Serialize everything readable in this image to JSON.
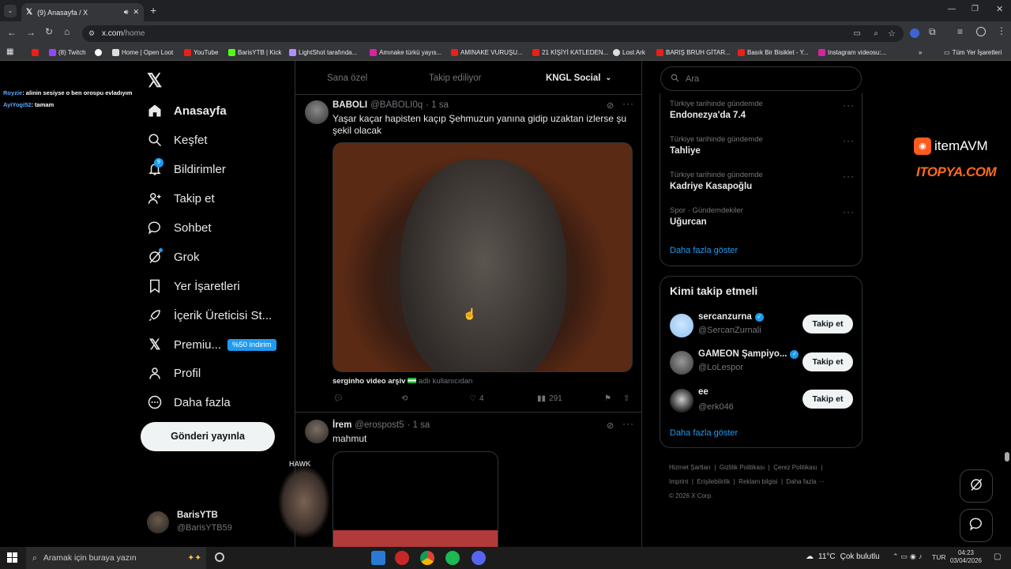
{
  "browser": {
    "tab_title": "(9) Anasayfa / X",
    "url_domain": "x.com",
    "url_path": "/home",
    "all_bookmarks": "Tüm Yer İşaretleri",
    "bookmarks": [
      "(8) Twitch",
      "Home | Open Loot",
      "YouTube",
      "BarisYTB | Kick",
      "LightShot tarafında...",
      "Amınake türkü yayıs...",
      "AMINAKE VURUŞU...",
      "21 KİŞİYİ KATLEDEN...",
      "Lost Ark",
      "BARIŞ BRUH GİTAR...",
      "Basık Bir Bisiklet - Y...",
      "Instagram videosu:..."
    ]
  },
  "stream_chat": [
    {
      "user": "Royzie",
      "msg": ": alinin sesiyse o ben orospu evladıyım"
    },
    {
      "user": "AyiYogi52",
      "msg": ": tamam"
    }
  ],
  "nav": {
    "items": [
      "Anasayfa",
      "Keşfet",
      "Bildirimler",
      "Takip et",
      "Sohbet",
      "Grok",
      "Yer İşaretleri",
      "İçerik Üreticisi St...",
      "Premiu...",
      "Profil",
      "Daha fazla"
    ],
    "notif_count": "9",
    "premium_badge": "%50 indirim",
    "post_button": "Gönderi yayınla",
    "account_name": "BarisYTB",
    "account_handle": "@BarisYTB59"
  },
  "feed_tabs": [
    "Sana özel",
    "Takip ediliyor",
    "KNGL Social"
  ],
  "tweets": [
    {
      "name": "BABOLI",
      "handle": "@BABOLI0q",
      "time": "· 1 sa",
      "text": "Yaşar kaçar hapisten kaçıp Şehmuzun yanına gidip uzaktan izlerse şu şekil olacak",
      "source_bold": "serginho video arşiv",
      "source_rest": "adlı kullanıcıdan",
      "likes": "4",
      "views": "291"
    },
    {
      "name": "İrem",
      "handle": "@erospost5",
      "time": "· 1 sa",
      "text": "mahmut"
    }
  ],
  "search": {
    "placeholder": "Ara"
  },
  "trends": [
    {
      "cat": "Türkiye tarihinde gündemde",
      "name": "Endonezya'da 7.4"
    },
    {
      "cat": "Türkiye tarihinde gündemde",
      "name": "Tahliye"
    },
    {
      "cat": "Türkiye tarihinde gündemde",
      "name": "Kadriye Kasapoğlu"
    },
    {
      "cat": "Spor · Gündemdekiler",
      "name": "Uğurcan"
    }
  ],
  "show_more": "Daha fazla göster",
  "who_to_follow": {
    "title": "Kimi takip etmeli",
    "users": [
      {
        "name": "sercanzurna",
        "handle": "@SercanZurnali",
        "btn": "Takip et"
      },
      {
        "name": "GAMEON Şampiyo...",
        "handle": "@LoLespor",
        "btn": "Takip et"
      },
      {
        "name": "ee",
        "handle": "@erk046",
        "btn": "Takip et"
      }
    ],
    "show_more": "Daha fazla göster"
  },
  "footer": {
    "links": [
      "Hizmet Şartları",
      "Gizlilik Politikası",
      "Çerez Politikası",
      "Imprint",
      "Erişilebilirlik",
      "Reklam bilgisi",
      "Daha fazla ···"
    ],
    "copyright": "© 2026 X Corp."
  },
  "overlay": {
    "logo1": "itemAVM",
    "logo2": "ITOPYA.COM",
    "cam_text": "HAWK"
  },
  "taskbar": {
    "search": "Aramak için buraya yazın",
    "weather_temp": "11°C",
    "weather_text": "Çok bulutlu",
    "lang": "TUR",
    "time": "04:23",
    "date": "03/04/2026"
  }
}
